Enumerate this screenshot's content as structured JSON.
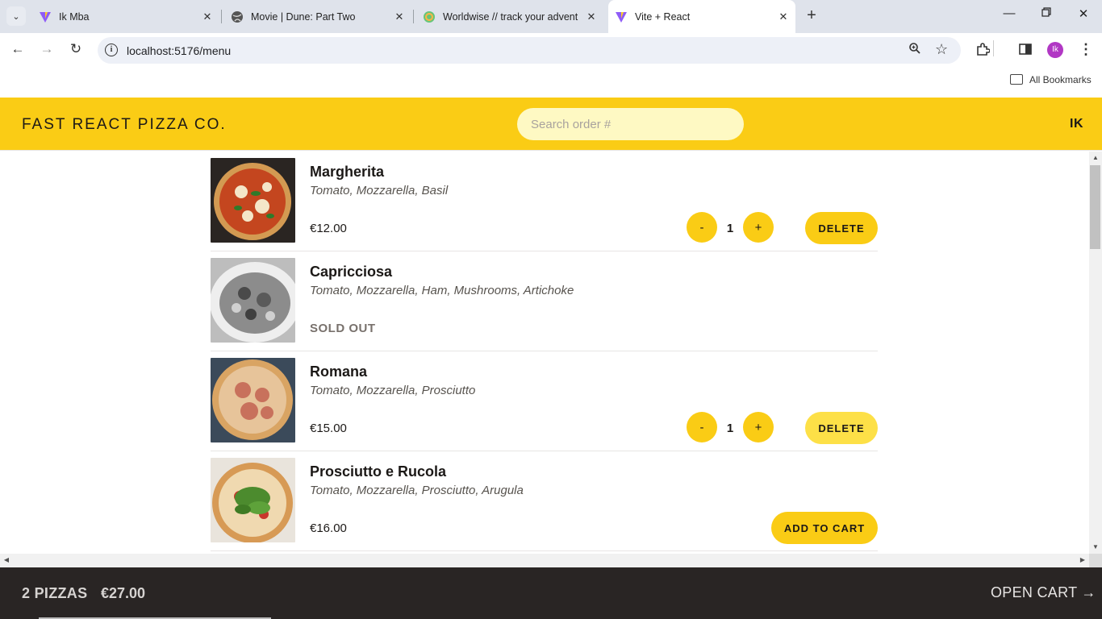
{
  "browser": {
    "tabs": [
      {
        "title": "Ik Mba",
        "favicon": "vite-icon",
        "active": false
      },
      {
        "title": "Movie | Dune: Part Two",
        "favicon": "globe-icon",
        "active": false
      },
      {
        "title": "Worldwise // track your adventu",
        "favicon": "worldwise-icon",
        "active": false
      },
      {
        "title": "Vite + React",
        "favicon": "vite-icon",
        "active": true
      }
    ],
    "url": "localhost:5176/menu",
    "profile_initials": "Ik",
    "bookmarks_label": "All Bookmarks"
  },
  "header": {
    "logo": "FAST REACT PIZZA CO.",
    "search_placeholder": "Search order #",
    "username": "IK"
  },
  "menu": [
    {
      "name": "Margherita",
      "ingredients": "Tomato, Mozzarella, Basil",
      "price": "€12.00",
      "sold_out": false,
      "in_cart": true,
      "quantity": "1",
      "delete_label": "DELETE"
    },
    {
      "name": "Capricciosa",
      "ingredients": "Tomato, Mozzarella, Ham, Mushrooms, Artichoke",
      "sold_out": true,
      "sold_out_label": "SOLD OUT"
    },
    {
      "name": "Romana",
      "ingredients": "Tomato, Mozzarella, Prosciutto",
      "price": "€15.00",
      "sold_out": false,
      "in_cart": true,
      "quantity": "1",
      "delete_label": "DELETE"
    },
    {
      "name": "Prosciutto e Rucola",
      "ingredients": "Tomato, Mozzarella, Prosciutto, Arugula",
      "price": "€16.00",
      "sold_out": false,
      "in_cart": false,
      "add_label": "ADD TO CART"
    }
  ],
  "controls": {
    "decrement": "-",
    "increment": "+"
  },
  "cart": {
    "count": "2 PIZZAS",
    "total": "€27.00",
    "open_label": "OPEN CART →"
  },
  "colors": {
    "accent": "#facc15",
    "search_bg": "#fef9c3",
    "footer_bg": "#292524",
    "text": "#1c1917"
  }
}
